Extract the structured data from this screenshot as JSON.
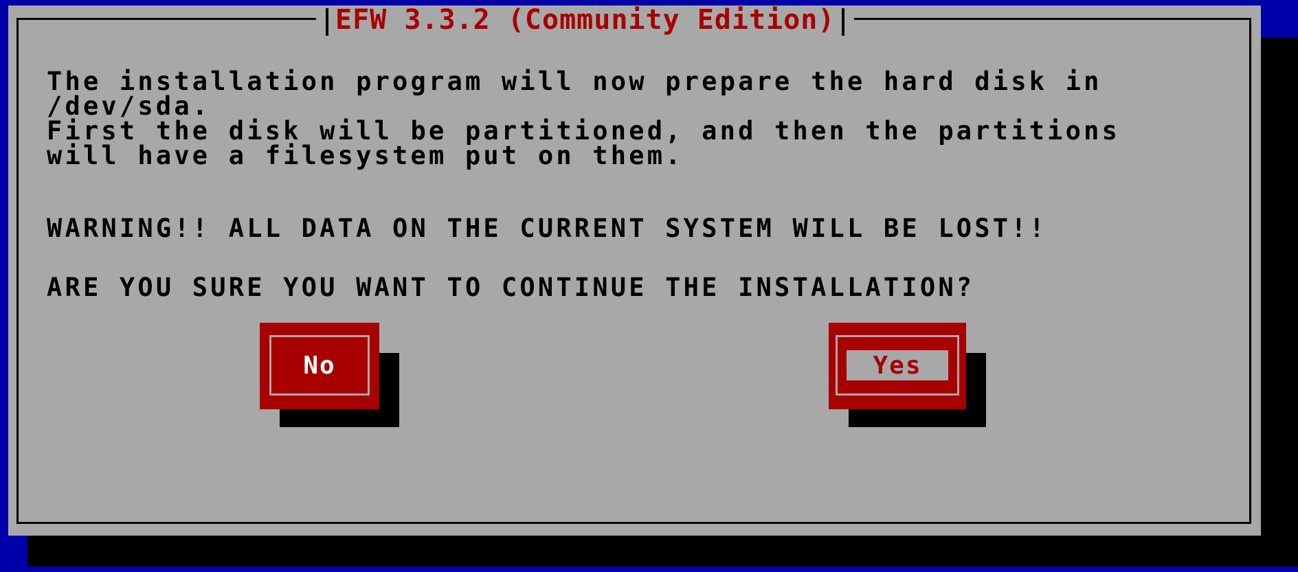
{
  "dialog": {
    "title": "EFW 3.3.2 (Community Edition)",
    "message": "The installation program will now prepare the hard disk in\n/dev/sda.\nFirst the disk will be partitioned, and then the partitions\nwill have a filesystem put on them.",
    "warning": "WARNING!! ALL DATA ON THE CURRENT SYSTEM WILL BE LOST!!",
    "question": "ARE YOU SURE YOU WANT TO CONTINUE THE INSTALLATION?"
  },
  "buttons": {
    "no_label": "No",
    "yes_label": "Yes",
    "focused": "Yes"
  },
  "colors": {
    "background": "#0000a8",
    "dialog": "#a8a8a8",
    "accent": "#a80000",
    "shadow": "#000000"
  }
}
